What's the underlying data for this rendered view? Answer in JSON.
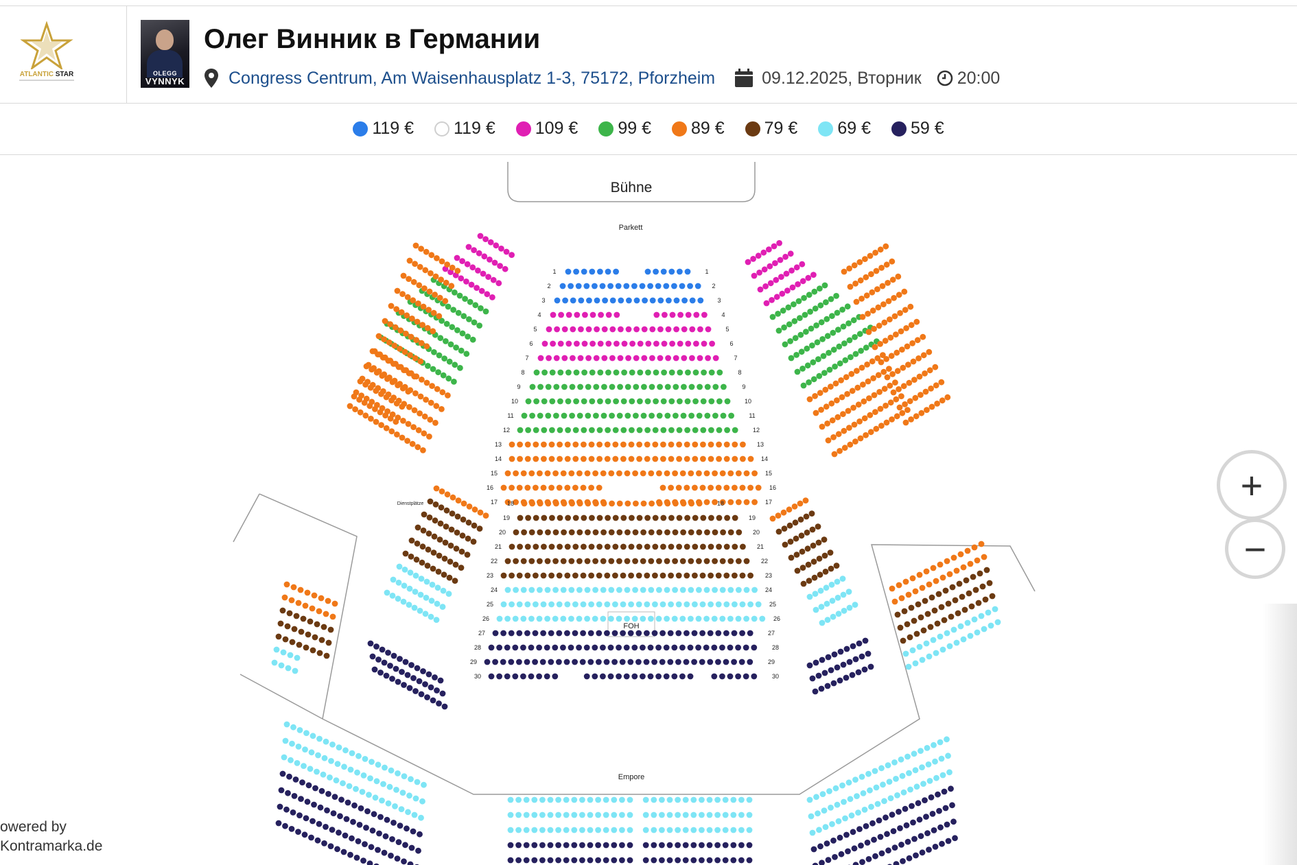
{
  "header": {
    "logo_alt": "ATLANTIC STAR ENTERTAINMENT",
    "poster_line1": "OLEGG",
    "poster_line2": "VYNNYK",
    "title": "Олег Винник в Германии",
    "venue": "Congress Centrum, Am Waisenhausplatz 1-3, 75172, Pforzheim",
    "date": "09.12.2025, Вторник",
    "time": "20:00"
  },
  "legend": [
    {
      "label": "119 €",
      "color": "#2b7de9"
    },
    {
      "label": "119 €",
      "color": "#ffffff"
    },
    {
      "label": "109 €",
      "color": "#e01fb3"
    },
    {
      "label": "99 €",
      "color": "#3db54a"
    },
    {
      "label": "89 €",
      "color": "#f07818"
    },
    {
      "label": "79 €",
      "color": "#6b3a12"
    },
    {
      "label": "69 €",
      "color": "#7ee5f5"
    },
    {
      "label": "59 €",
      "color": "#26215e"
    }
  ],
  "seatmap": {
    "stage_label": "Bühne",
    "parkett_label": "Parkett",
    "foh_label": "FOH",
    "empore_label": "Empore",
    "dienstplatze_label": "Dienstplätze"
  },
  "controls": {
    "zoom_in": "+",
    "zoom_out": "−"
  },
  "footer": {
    "powered_line1": "owered by",
    "powered_line2": "Kontramarka.de"
  }
}
